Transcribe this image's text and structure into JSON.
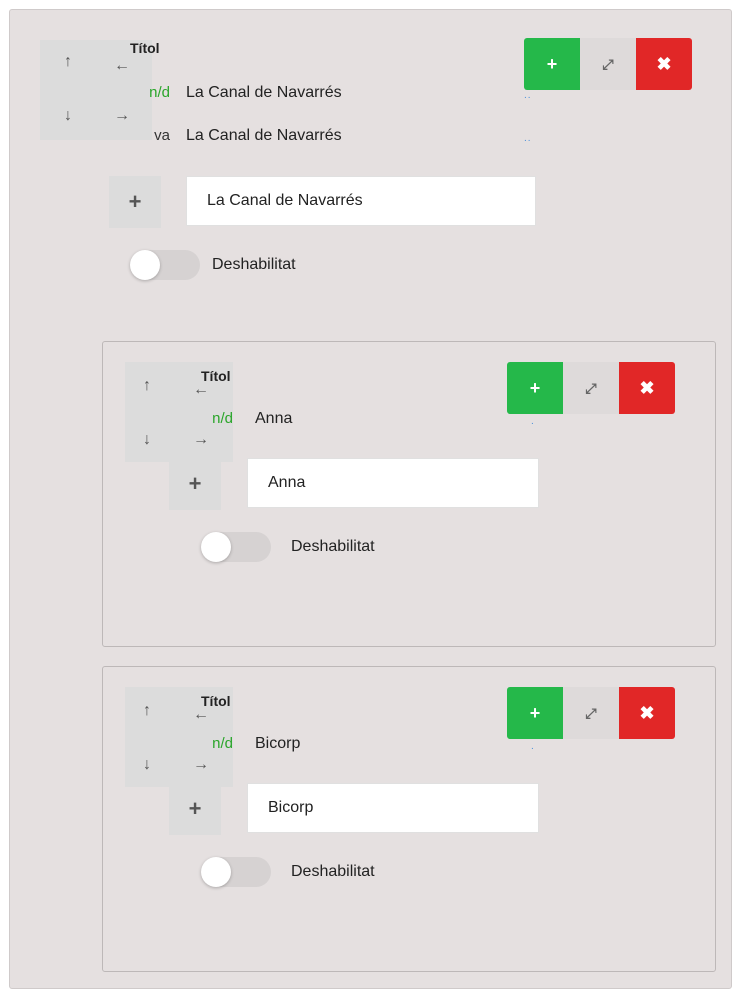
{
  "main": {
    "title_label": "Títol",
    "rows": [
      {
        "lang": "n/d",
        "value": "La Canal de Navarrés"
      },
      {
        "lang": "va",
        "value": "La Canal de Navarrés"
      }
    ],
    "input_value": "La Canal de Navarrés",
    "toggle_label": "Deshabilitat",
    "dots": ".."
  },
  "children": [
    {
      "title_label": "Títol",
      "lang": "n/d",
      "value": "Anna",
      "input_value": "Anna",
      "toggle_label": "Deshabilitat",
      "dots": "."
    },
    {
      "title_label": "Títol",
      "lang": "n/d",
      "value": "Bicorp",
      "input_value": "Bicorp",
      "toggle_label": "Deshabilitat",
      "dots": "."
    }
  ],
  "icons": {
    "up": "↑",
    "down": "↓",
    "left": "←",
    "right": "→",
    "plus": "+",
    "expand": "⤢",
    "close": "✖"
  },
  "colors": {
    "add": "#25b84a",
    "delete": "#e12727",
    "lang_nd": "#2aa52a"
  }
}
